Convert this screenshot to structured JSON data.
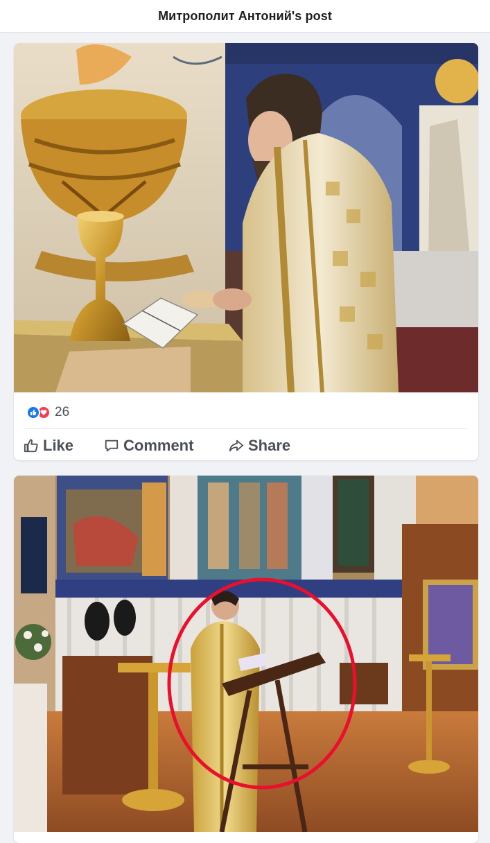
{
  "header": {
    "title": "Митрополит Антоний's post"
  },
  "posts": [
    {
      "image": "photo: bishop in white-and-gold vestments at altar with chalice and open book, icon-painted walls",
      "reactions": {
        "icons": [
          "like-icon",
          "love-icon"
        ],
        "count": "26"
      },
      "actions": {
        "like": "Like",
        "comment": "Comment",
        "share": "Share"
      }
    },
    {
      "image": "photo: church interior, man in gold vestment reading at a lectern, circled in red"
    }
  ],
  "colors": {
    "like": "#1877f2",
    "love": "#f33e58",
    "annotation": "#e8102c"
  }
}
